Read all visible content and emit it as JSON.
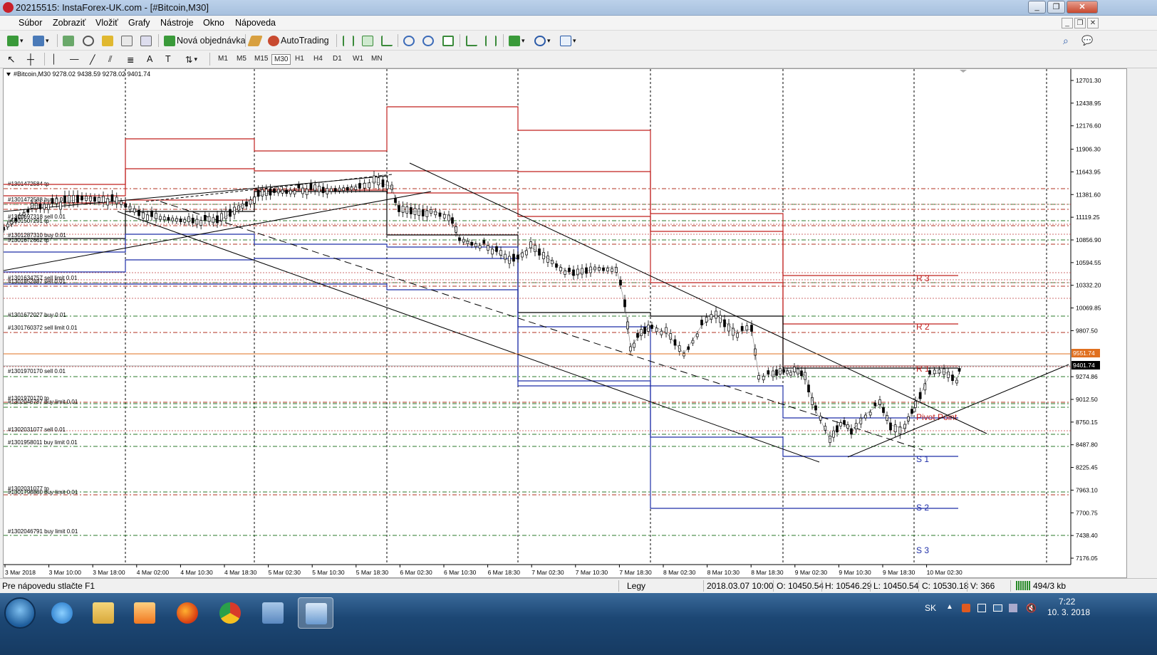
{
  "window": {
    "title": "20215515: InstaForex-UK.com - [#Bitcoin,M30]",
    "controls": [
      "_",
      "❐",
      "✕"
    ]
  },
  "menu": [
    "Súbor",
    "Zobraziť",
    "Vložiť",
    "Grafy",
    "Nástroje",
    "Okno",
    "Nápoveda"
  ],
  "toolbar": {
    "new_order": "Nová objednávka",
    "autotrading": "AutoTrading"
  },
  "timeframes": [
    "M1",
    "M5",
    "M15",
    "M30",
    "H1",
    "H4",
    "D1",
    "W1",
    "MN"
  ],
  "active_timeframe": "M30",
  "chart": {
    "header": "#Bitcoin,M30  9278.02 9438.59 9278.02 9401.74",
    "price_labels": [
      "12701.30",
      "12438.95",
      "12176.60",
      "11906.30",
      "11643.95",
      "11381.60",
      "11119.25",
      "10856.90",
      "10594.55",
      "10332.20",
      "10069.85",
      "9807.50",
      "9274.86",
      "9012.50",
      "8750.15",
      "8487.80",
      "8225.45",
      "7963.10",
      "7700.75",
      "7438.40",
      "7176.05"
    ],
    "time_labels": [
      "3 Mar 2018",
      "3 Mar 10:00",
      "3 Mar 18:00",
      "4 Mar 02:00",
      "4 Mar 10:30",
      "4 Mar 18:30",
      "5 Mar 02:30",
      "5 Mar 10:30",
      "5 Mar 18:30",
      "6 Mar 02:30",
      "6 Mar 10:30",
      "6 Mar 18:30",
      "7 Mar 02:30",
      "7 Mar 10:30",
      "7 Mar 18:30",
      "8 Mar 02:30",
      "8 Mar 10:30",
      "8 Mar 18:30",
      "9 Mar 02:30",
      "9 Mar 10:30",
      "9 Mar 18:30",
      "10 Mar 02:30"
    ],
    "current_price": "9401.74",
    "alert_price": "9551.74",
    "order_labels": [
      "#1301472584 tp",
      "#1301472588 buy 0.01",
      "#1301697318 sell 0.01",
      "#1301507291 tp",
      "#1301287310 buy 0.01",
      "#1301672662 tp",
      "#1301634757 sell limit 0.01",
      "#1301852887 sell 0.01",
      "#1301672027 buy 0.01",
      "#1301760372 sell limit 0.01",
      "#1301970170 sell 0.01",
      "#1301970170 tp",
      "#1302046787 buy limit 0.01",
      "#1302031077 sell 0.01",
      "#1301958011 buy limit 0.01",
      "#1302031077 tp",
      "#1301798880 buy limit 0.01",
      "#1302046791 buy limit 0.01"
    ],
    "pivot_labels": [
      "R 3",
      "R 2",
      "R 1",
      "Pivot Point",
      "S 1",
      "S 2",
      "S 3"
    ],
    "colors": {
      "resistance": "#c0201e",
      "support": "#1f2fa8",
      "candle": "#000000",
      "alert": "#e07020",
      "buy_level": "#2a7a2a",
      "sell_level": "#b03020"
    }
  },
  "status": {
    "help": "Pre nápovedu stlačte F1",
    "profile": "Legy",
    "datetime": "2018.03.07 10:00",
    "open": "O: 10450.54",
    "high": "H: 10546.29",
    "low": "L: 10450.54",
    "close": "C: 10530.18",
    "volume": "V: 366",
    "traffic": "494/3 kb"
  },
  "taskbar": {
    "lang": "SK",
    "time": "7:22",
    "date": "10. 3. 2018",
    "apps": [
      "internet-explorer",
      "file-explorer",
      "media-player",
      "firefox",
      "chrome",
      "network-app",
      "metatrader"
    ]
  }
}
